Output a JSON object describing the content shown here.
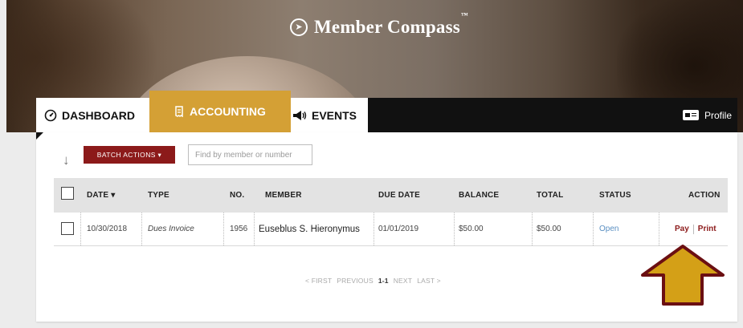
{
  "app": {
    "title": "Member Compass",
    "trademark": "™",
    "logo_icon": "compass-icon"
  },
  "nav": {
    "tabs": [
      {
        "label": "DASHBOARD",
        "icon": "speedometer-icon",
        "active": false
      },
      {
        "label": "ACCOUNTING",
        "icon": "receipt-icon",
        "active": true
      },
      {
        "label": "EVENTS",
        "icon": "megaphone-icon",
        "active": false
      }
    ],
    "profile": {
      "label": "Profile",
      "icon": "id-card-icon"
    }
  },
  "colors": {
    "accent": "#d4a035",
    "brand_red": "#8c1a1a",
    "nav_bg": "#111111",
    "table_header": "#e3e3e3"
  },
  "toolbar": {
    "batch_actions": "BATCH ACTIONS ▾",
    "search_placeholder": "Find by member or number"
  },
  "table": {
    "headers": [
      "DATE ▾",
      "TYPE",
      "NO.",
      "MEMBER",
      "DUE DATE",
      "BALANCE",
      "TOTAL",
      "STATUS",
      "ACTION"
    ],
    "rows": [
      {
        "date": "10/30/2018",
        "type": "Dues Invoice",
        "no": "1956",
        "member": "Euseblus S. Hieronymus",
        "due_date": "01/01/2019",
        "balance": "$50.00",
        "total": "$50.00",
        "status": "Open",
        "actions": [
          "Pay",
          "Print"
        ]
      }
    ]
  },
  "pagination": {
    "first": "< FIRST",
    "previous": "PREVIOUS",
    "current": "1-1",
    "next": "NEXT",
    "last": "LAST >"
  },
  "annotation": {
    "icon": "up-arrow-callout",
    "fill": "#d4a017",
    "stroke": "#6b0f12"
  }
}
